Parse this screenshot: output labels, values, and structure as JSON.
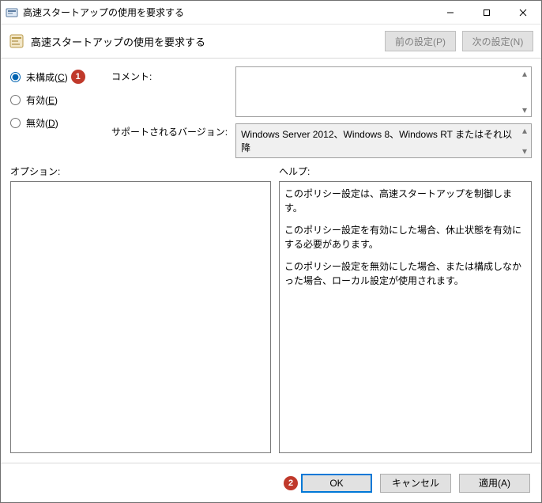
{
  "window": {
    "title": "高速スタートアップの使用を要求する"
  },
  "header": {
    "title": "高速スタートアップの使用を要求する",
    "prev_btn": "前の設定(P)",
    "next_btn": "次の設定(N)"
  },
  "radios": {
    "not_configured": "未構成",
    "not_configured_key": "C",
    "enabled": "有効",
    "enabled_key": "E",
    "disabled": "無効",
    "disabled_key": "D"
  },
  "labels": {
    "comment": "コメント:",
    "supported": "サポートされるバージョン:",
    "options": "オプション:",
    "help": "ヘルプ:"
  },
  "fields": {
    "comment": "",
    "supported": "Windows Server 2012、Windows 8、Windows RT またはそれ以降"
  },
  "help": {
    "p1": "このポリシー設定は、高速スタートアップを制御します。",
    "p2": "このポリシー設定を有効にした場合、休止状態を有効にする必要があります。",
    "p3": "このポリシー設定を無効にした場合、または構成しなかった場合、ローカル設定が使用されます。"
  },
  "footer": {
    "ok": "OK",
    "cancel": "キャンセル",
    "apply": "適用(A)"
  },
  "callouts": {
    "c1": "1",
    "c2": "2"
  }
}
